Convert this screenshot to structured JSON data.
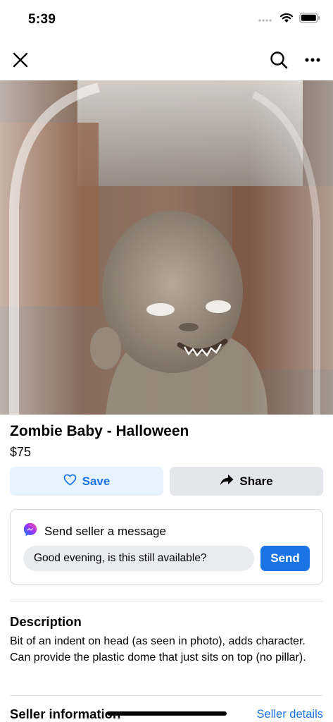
{
  "status_bar": {
    "time": "5:39",
    "icons": [
      "cellular-signal-icon",
      "wifi-icon",
      "battery-icon"
    ]
  },
  "nav": {
    "icons": [
      "close-icon",
      "search-icon",
      "more-icon"
    ]
  },
  "listing": {
    "title": "Zombie Baby - Halloween",
    "price": "$75",
    "photo_subject": "Zombie baby figure under a plastic dome"
  },
  "actions": {
    "save_label": "Save",
    "share_label": "Share",
    "save_icon": "heart-icon",
    "share_icon": "share-arrow-icon"
  },
  "message": {
    "header": "Send seller a message",
    "input_value": "Good evening, is this still available?",
    "send_label": "Send",
    "icon": "messenger-icon"
  },
  "description": {
    "heading": "Description",
    "body": "Bit of an indent on head (as seen in photo), adds character. Can provide the plastic dome that just sits on top (no pillar)."
  },
  "seller": {
    "heading": "Seller information",
    "details_link": "Seller details"
  },
  "colors": {
    "accent": "#1b74e4",
    "save_bg": "#e7f3ff",
    "share_bg": "#e4e6eb",
    "input_bg": "#e9ebee",
    "text": "#050505"
  }
}
